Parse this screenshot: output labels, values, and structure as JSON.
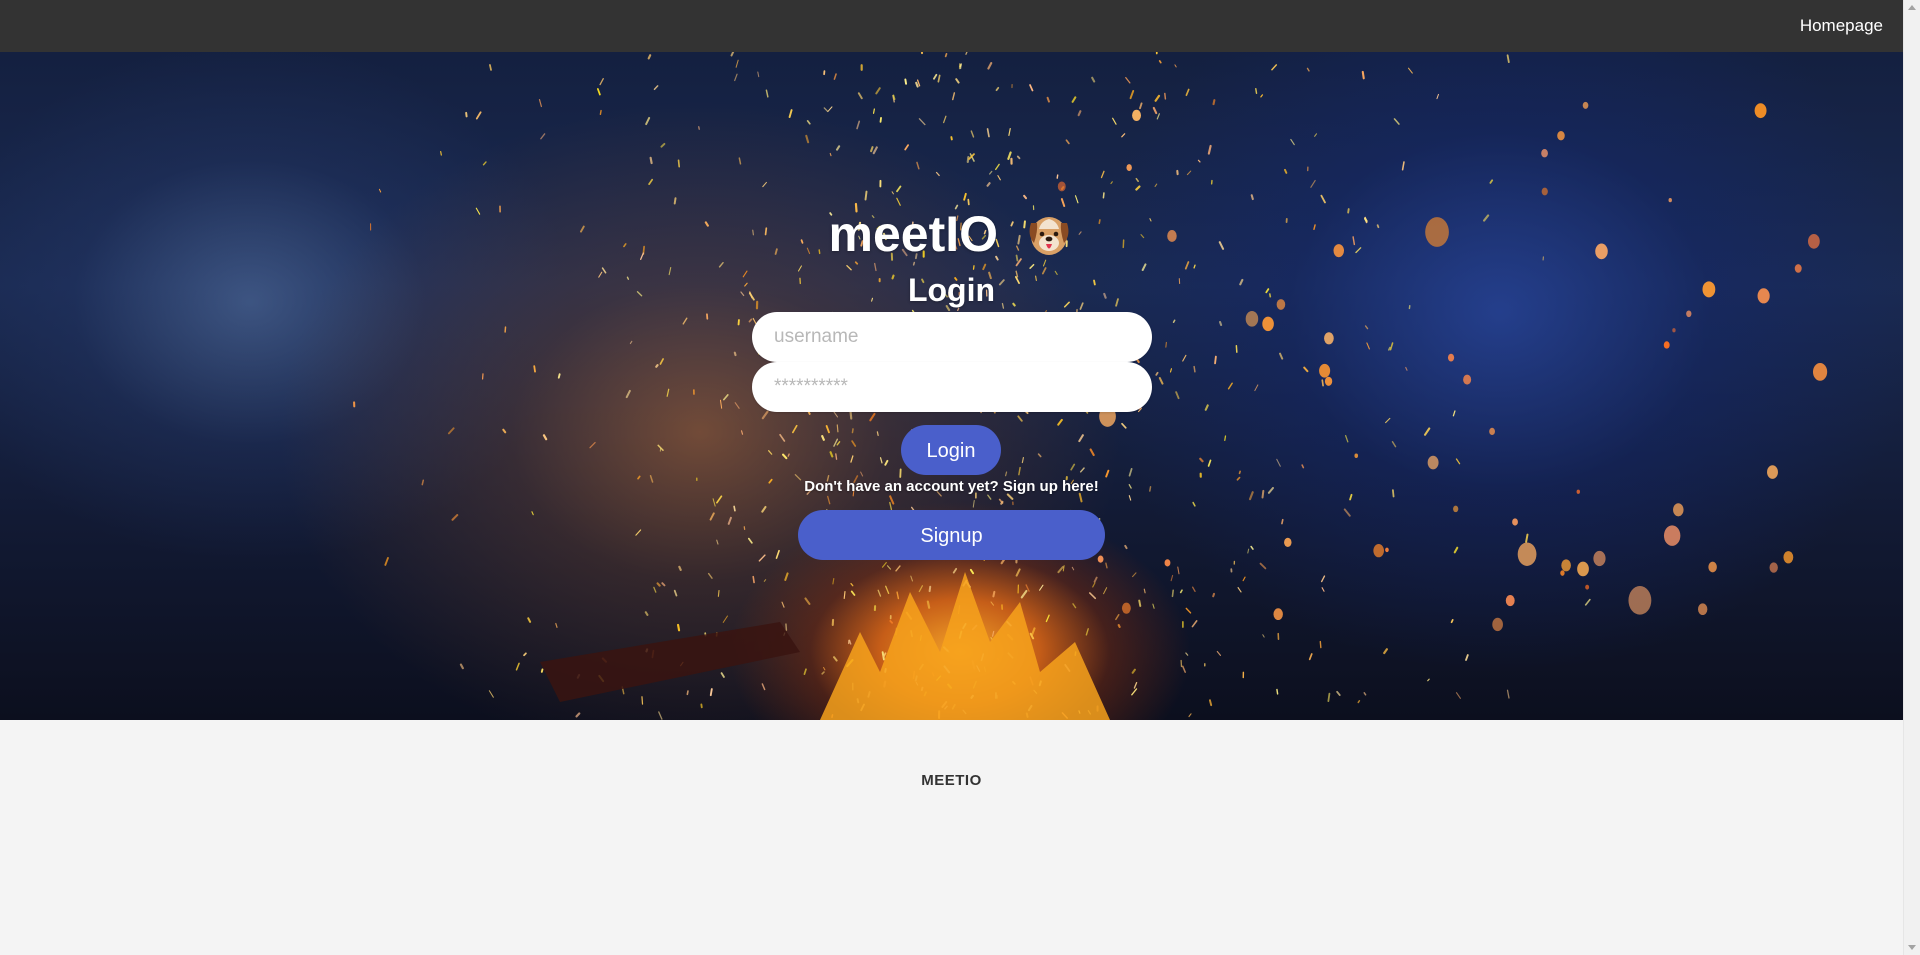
{
  "navbar": {
    "homepage_link": "Homepage"
  },
  "login": {
    "brand_title": "meetIO",
    "brand_icon": "dog-face-icon",
    "heading": "Login",
    "username_placeholder": "username",
    "password_placeholder": "**********",
    "login_button": "Login",
    "signup_prompt": "Don't have an account yet? Sign up here!",
    "signup_button": "Signup"
  },
  "footer": {
    "brand": "MEETIO"
  },
  "colors": {
    "navbar_bg": "#333333",
    "button_bg": "#4a5fcb",
    "footer_bg": "#f4f4f4",
    "text_light": "#ffffff"
  }
}
